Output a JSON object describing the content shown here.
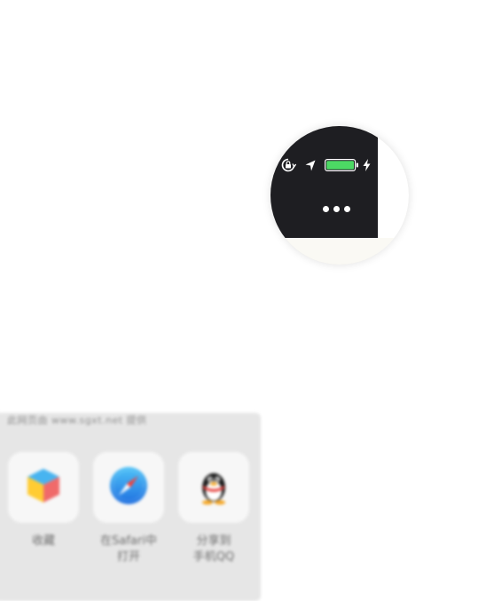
{
  "status_bar": {
    "icons": [
      "orientation-lock-icon",
      "location-arrow-icon",
      "battery-icon",
      "charging-bolt-icon"
    ],
    "battery_level": 1.0,
    "battery_color": "#4cd964"
  },
  "more_menu": {
    "icon": "more-dots-icon"
  },
  "share_sheet": {
    "header": "此网页由 www.sgxt.net 提供",
    "items": [
      {
        "label": "收藏",
        "icon": "favorite-cube-icon"
      },
      {
        "label": "在Safari中\n打开",
        "icon": "safari-compass-icon"
      },
      {
        "label": "分享到\n手机QQ",
        "icon": "qq-penguin-icon"
      }
    ]
  }
}
